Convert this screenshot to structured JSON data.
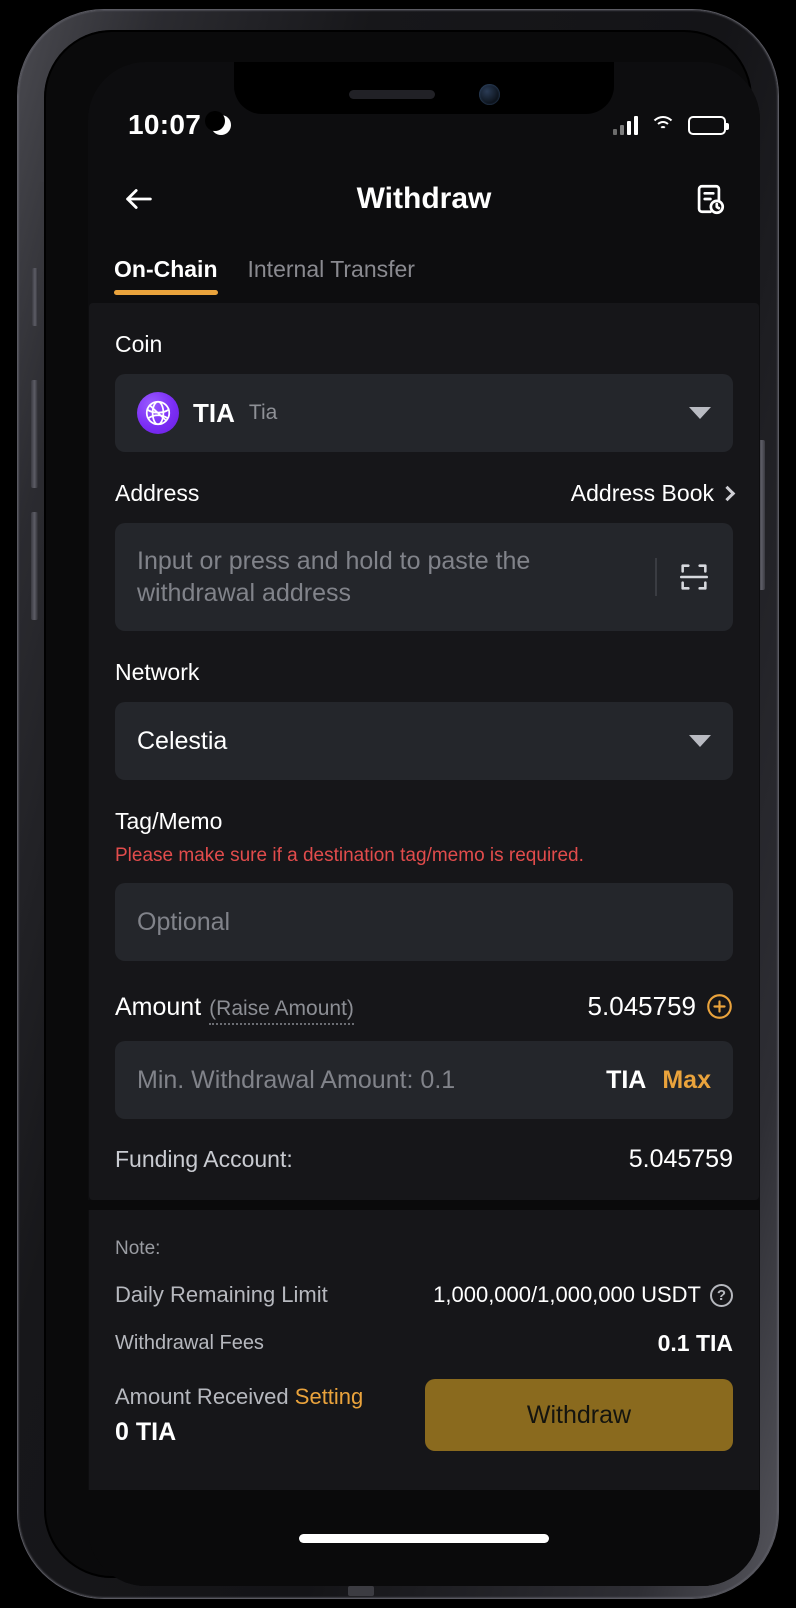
{
  "status_bar": {
    "time": "10:07",
    "dnd_icon": "crescent-moon-icon",
    "signal_icon": "cellular-signal-icon",
    "wifi_icon": "wifi-icon",
    "battery_icon": "battery-icon"
  },
  "header": {
    "back_icon": "back-arrow-icon",
    "title": "Withdraw",
    "history_icon": "withdrawal-history-icon"
  },
  "tabs": [
    {
      "label": "On-Chain",
      "active": true
    },
    {
      "label": "Internal Transfer",
      "active": false
    }
  ],
  "form": {
    "coin": {
      "label": "Coin",
      "symbol": "TIA",
      "name": "Tia",
      "logo_icon": "celestia-logo-icon",
      "caret_icon": "chevron-down-icon"
    },
    "address": {
      "label": "Address",
      "address_book_label": "Address Book",
      "address_book_chevron": "chevron-right-icon",
      "value": "",
      "placeholder": "Input or press and hold to paste the withdrawal address",
      "scan_icon": "qr-scan-icon"
    },
    "network": {
      "label": "Network",
      "value": "Celestia",
      "caret_icon": "chevron-down-icon"
    },
    "tag_memo": {
      "label": "Tag/Memo",
      "warning": "Please make sure if a destination tag/memo is required.",
      "value": "",
      "placeholder": "Optional"
    },
    "amount": {
      "label": "Amount",
      "raise_label": "(Raise Amount)",
      "available": "5.045759",
      "plus_icon": "plus-circle-icon",
      "value": "",
      "placeholder": "Min. Withdrawal Amount: 0.1",
      "unit": "TIA",
      "max_label": "Max"
    },
    "funding_account": {
      "label": "Funding Account:",
      "value": "5.045759"
    }
  },
  "note": {
    "title": "Note:",
    "rows": [
      {
        "label": "Daily Remaining Limit",
        "value": "1,000,000/1,000,000 USDT",
        "help_icon": "question-mark-icon"
      },
      {
        "label": "Withdrawal Fees",
        "value": "0.1 TIA"
      }
    ],
    "received_label": "Amount Received",
    "setting_label": "Setting",
    "received_value": "0 TIA",
    "withdraw_button": "Withdraw"
  },
  "colors": {
    "accent": "#eaa33c",
    "warning": "#e24c4c",
    "coin_brand": "#7b2df5",
    "button_disabled": "#8a6a1e",
    "screen_bg": "#0d0d0f",
    "card_bg": "#161619",
    "field_bg": "#24262b"
  }
}
